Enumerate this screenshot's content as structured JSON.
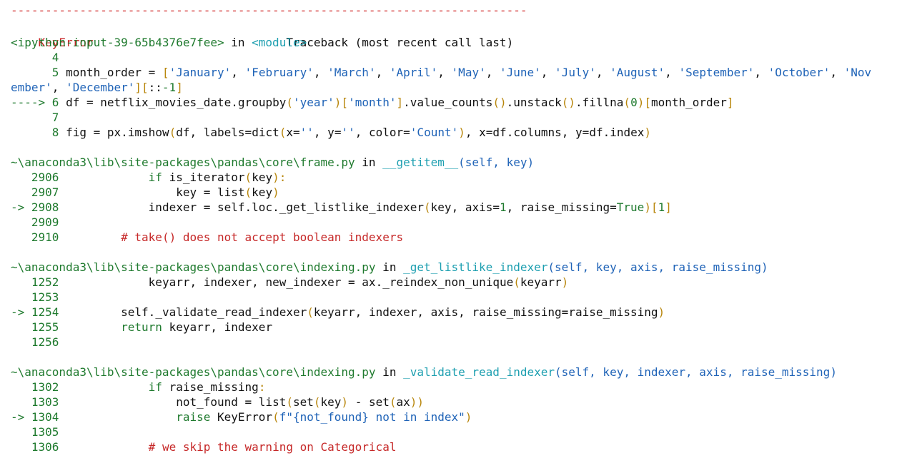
{
  "header": {
    "rule": "---------------------------------------------------------------------------",
    "error_name": "KeyError",
    "traceback_label": "Traceback (most recent call last)"
  },
  "frames": [
    {
      "location": "<ipython-input-39-65b4376e7fee>",
      "in_word": "in",
      "func": "<module>",
      "args": "",
      "lines": [
        {
          "no": "4",
          "arrow": "",
          "segments": []
        },
        {
          "no": "5",
          "arrow": "",
          "segments": [
            {
              "t": "month_order ",
              "c": "plain"
            },
            {
              "t": "= ",
              "c": "plain"
            },
            {
              "t": "[",
              "c": "punc"
            },
            {
              "t": "'January'",
              "c": "str"
            },
            {
              "t": ", ",
              "c": "plain"
            },
            {
              "t": "'February'",
              "c": "str"
            },
            {
              "t": ", ",
              "c": "plain"
            },
            {
              "t": "'March'",
              "c": "str"
            },
            {
              "t": ", ",
              "c": "plain"
            },
            {
              "t": "'April'",
              "c": "str"
            },
            {
              "t": ", ",
              "c": "plain"
            },
            {
              "t": "'May'",
              "c": "str"
            },
            {
              "t": ", ",
              "c": "plain"
            },
            {
              "t": "'June'",
              "c": "str"
            },
            {
              "t": ", ",
              "c": "plain"
            },
            {
              "t": "'July'",
              "c": "str"
            },
            {
              "t": ", ",
              "c": "plain"
            },
            {
              "t": "'August'",
              "c": "str"
            },
            {
              "t": ", ",
              "c": "plain"
            },
            {
              "t": "'September'",
              "c": "str"
            },
            {
              "t": ", ",
              "c": "plain"
            },
            {
              "t": "'October'",
              "c": "str"
            },
            {
              "t": ", ",
              "c": "plain"
            },
            {
              "t": "'Nov",
              "c": "str"
            }
          ]
        },
        {
          "no": "",
          "arrow": "",
          "continuation": true,
          "segments": [
            {
              "t": "ember'",
              "c": "str"
            },
            {
              "t": ", ",
              "c": "plain"
            },
            {
              "t": "'December'",
              "c": "str"
            },
            {
              "t": "][",
              "c": "punc"
            },
            {
              "t": "::",
              "c": "plain"
            },
            {
              "t": "-1",
              "c": "num"
            },
            {
              "t": "]",
              "c": "punc"
            }
          ]
        },
        {
          "no": "6",
          "arrow": "---->",
          "segments": [
            {
              "t": "df ",
              "c": "plain"
            },
            {
              "t": "= ",
              "c": "plain"
            },
            {
              "t": "netflix_movies_date",
              "c": "plain"
            },
            {
              "t": ".",
              "c": "plain"
            },
            {
              "t": "groupby",
              "c": "plain"
            },
            {
              "t": "(",
              "c": "punc"
            },
            {
              "t": "'year'",
              "c": "str"
            },
            {
              "t": ")[",
              "c": "punc"
            },
            {
              "t": "'month'",
              "c": "str"
            },
            {
              "t": "]",
              "c": "punc"
            },
            {
              "t": ".",
              "c": "plain"
            },
            {
              "t": "value_counts",
              "c": "plain"
            },
            {
              "t": "()",
              "c": "punc"
            },
            {
              "t": ".",
              "c": "plain"
            },
            {
              "t": "unstack",
              "c": "plain"
            },
            {
              "t": "()",
              "c": "punc"
            },
            {
              "t": ".",
              "c": "plain"
            },
            {
              "t": "fillna",
              "c": "plain"
            },
            {
              "t": "(",
              "c": "punc"
            },
            {
              "t": "0",
              "c": "num"
            },
            {
              "t": ")[",
              "c": "punc"
            },
            {
              "t": "month_order",
              "c": "plain"
            },
            {
              "t": "]",
              "c": "punc"
            }
          ]
        },
        {
          "no": "7",
          "arrow": "",
          "segments": []
        },
        {
          "no": "8",
          "arrow": "",
          "segments": [
            {
              "t": "fig ",
              "c": "plain"
            },
            {
              "t": "= ",
              "c": "plain"
            },
            {
              "t": "px",
              "c": "plain"
            },
            {
              "t": ".",
              "c": "plain"
            },
            {
              "t": "imshow",
              "c": "plain"
            },
            {
              "t": "(",
              "c": "punc"
            },
            {
              "t": "df",
              "c": "plain"
            },
            {
              "t": ", ",
              "c": "plain"
            },
            {
              "t": "labels",
              "c": "plain"
            },
            {
              "t": "=",
              "c": "plain"
            },
            {
              "t": "dict",
              "c": "plain"
            },
            {
              "t": "(",
              "c": "punc"
            },
            {
              "t": "x",
              "c": "plain"
            },
            {
              "t": "=",
              "c": "plain"
            },
            {
              "t": "''",
              "c": "str"
            },
            {
              "t": ", ",
              "c": "plain"
            },
            {
              "t": "y",
              "c": "plain"
            },
            {
              "t": "=",
              "c": "plain"
            },
            {
              "t": "''",
              "c": "str"
            },
            {
              "t": ", ",
              "c": "plain"
            },
            {
              "t": "color",
              "c": "plain"
            },
            {
              "t": "=",
              "c": "plain"
            },
            {
              "t": "'Count'",
              "c": "str"
            },
            {
              "t": ")",
              "c": "punc"
            },
            {
              "t": ", ",
              "c": "plain"
            },
            {
              "t": "x",
              "c": "plain"
            },
            {
              "t": "=",
              "c": "plain"
            },
            {
              "t": "df",
              "c": "plain"
            },
            {
              "t": ".",
              "c": "plain"
            },
            {
              "t": "columns",
              "c": "plain"
            },
            {
              "t": ", ",
              "c": "plain"
            },
            {
              "t": "y",
              "c": "plain"
            },
            {
              "t": "=",
              "c": "plain"
            },
            {
              "t": "df",
              "c": "plain"
            },
            {
              "t": ".",
              "c": "plain"
            },
            {
              "t": "index",
              "c": "plain"
            },
            {
              "t": ")",
              "c": "punc"
            }
          ]
        }
      ]
    },
    {
      "location": "~\\anaconda3\\lib\\site-packages\\pandas\\core\\frame.py",
      "in_word": "in",
      "func": "__getitem__",
      "args": "(self, key)",
      "lines": [
        {
          "no": "2906",
          "arrow": "",
          "segments": [
            {
              "t": "            ",
              "c": "plain"
            },
            {
              "t": "if ",
              "c": "kw"
            },
            {
              "t": "is_iterator",
              "c": "plain"
            },
            {
              "t": "(",
              "c": "punc"
            },
            {
              "t": "key",
              "c": "plain"
            },
            {
              "t": "):",
              "c": "punc"
            }
          ]
        },
        {
          "no": "2907",
          "arrow": "",
          "segments": [
            {
              "t": "                ",
              "c": "plain"
            },
            {
              "t": "key ",
              "c": "plain"
            },
            {
              "t": "= ",
              "c": "plain"
            },
            {
              "t": "list",
              "c": "plain"
            },
            {
              "t": "(",
              "c": "punc"
            },
            {
              "t": "key",
              "c": "plain"
            },
            {
              "t": ")",
              "c": "punc"
            }
          ]
        },
        {
          "no": "2908",
          "arrow": "->",
          "segments": [
            {
              "t": "            ",
              "c": "plain"
            },
            {
              "t": "indexer ",
              "c": "plain"
            },
            {
              "t": "= ",
              "c": "plain"
            },
            {
              "t": "self",
              "c": "plain"
            },
            {
              "t": ".",
              "c": "plain"
            },
            {
              "t": "loc",
              "c": "plain"
            },
            {
              "t": ".",
              "c": "plain"
            },
            {
              "t": "_get_listlike_indexer",
              "c": "plain"
            },
            {
              "t": "(",
              "c": "punc"
            },
            {
              "t": "key",
              "c": "plain"
            },
            {
              "t": ", ",
              "c": "plain"
            },
            {
              "t": "axis",
              "c": "plain"
            },
            {
              "t": "=",
              "c": "plain"
            },
            {
              "t": "1",
              "c": "num"
            },
            {
              "t": ", ",
              "c": "plain"
            },
            {
              "t": "raise_missing",
              "c": "plain"
            },
            {
              "t": "=",
              "c": "plain"
            },
            {
              "t": "True",
              "c": "kw"
            },
            {
              "t": ")[",
              "c": "punc"
            },
            {
              "t": "1",
              "c": "num"
            },
            {
              "t": "]",
              "c": "punc"
            }
          ]
        },
        {
          "no": "2909",
          "arrow": "",
          "segments": []
        },
        {
          "no": "2910",
          "arrow": "",
          "segments": [
            {
              "t": "        ",
              "c": "plain"
            },
            {
              "t": "# take() does not accept boolean indexers",
              "c": "comment"
            }
          ]
        }
      ]
    },
    {
      "location": "~\\anaconda3\\lib\\site-packages\\pandas\\core\\indexing.py",
      "in_word": "in",
      "func": "_get_listlike_indexer",
      "args": "(self, key, axis, raise_missing)",
      "lines": [
        {
          "no": "1252",
          "arrow": "",
          "segments": [
            {
              "t": "            ",
              "c": "plain"
            },
            {
              "t": "keyarr",
              "c": "plain"
            },
            {
              "t": ", ",
              "c": "plain"
            },
            {
              "t": "indexer",
              "c": "plain"
            },
            {
              "t": ", ",
              "c": "plain"
            },
            {
              "t": "new_indexer ",
              "c": "plain"
            },
            {
              "t": "= ",
              "c": "plain"
            },
            {
              "t": "ax",
              "c": "plain"
            },
            {
              "t": ".",
              "c": "plain"
            },
            {
              "t": "_reindex_non_unique",
              "c": "plain"
            },
            {
              "t": "(",
              "c": "punc"
            },
            {
              "t": "keyarr",
              "c": "plain"
            },
            {
              "t": ")",
              "c": "punc"
            }
          ]
        },
        {
          "no": "1253",
          "arrow": "",
          "segments": []
        },
        {
          "no": "1254",
          "arrow": "->",
          "segments": [
            {
              "t": "        ",
              "c": "plain"
            },
            {
              "t": "self",
              "c": "plain"
            },
            {
              "t": ".",
              "c": "plain"
            },
            {
              "t": "_validate_read_indexer",
              "c": "plain"
            },
            {
              "t": "(",
              "c": "punc"
            },
            {
              "t": "keyarr",
              "c": "plain"
            },
            {
              "t": ", ",
              "c": "plain"
            },
            {
              "t": "indexer",
              "c": "plain"
            },
            {
              "t": ", ",
              "c": "plain"
            },
            {
              "t": "axis",
              "c": "plain"
            },
            {
              "t": ", ",
              "c": "plain"
            },
            {
              "t": "raise_missing",
              "c": "plain"
            },
            {
              "t": "=",
              "c": "plain"
            },
            {
              "t": "raise_missing",
              "c": "plain"
            },
            {
              "t": ")",
              "c": "punc"
            }
          ]
        },
        {
          "no": "1255",
          "arrow": "",
          "segments": [
            {
              "t": "        ",
              "c": "plain"
            },
            {
              "t": "return ",
              "c": "kw"
            },
            {
              "t": "keyarr",
              "c": "plain"
            },
            {
              "t": ", ",
              "c": "plain"
            },
            {
              "t": "indexer",
              "c": "plain"
            }
          ]
        },
        {
          "no": "1256",
          "arrow": "",
          "segments": []
        }
      ]
    },
    {
      "location": "~\\anaconda3\\lib\\site-packages\\pandas\\core\\indexing.py",
      "in_word": "in",
      "func": "_validate_read_indexer",
      "args": "(self, key, indexer, axis, raise_missing)",
      "lines": [
        {
          "no": "1302",
          "arrow": "",
          "segments": [
            {
              "t": "            ",
              "c": "plain"
            },
            {
              "t": "if ",
              "c": "kw"
            },
            {
              "t": "raise_missing",
              "c": "plain"
            },
            {
              "t": ":",
              "c": "punc"
            }
          ]
        },
        {
          "no": "1303",
          "arrow": "",
          "segments": [
            {
              "t": "                ",
              "c": "plain"
            },
            {
              "t": "not_found ",
              "c": "plain"
            },
            {
              "t": "= ",
              "c": "plain"
            },
            {
              "t": "list",
              "c": "plain"
            },
            {
              "t": "(",
              "c": "punc"
            },
            {
              "t": "set",
              "c": "plain"
            },
            {
              "t": "(",
              "c": "punc"
            },
            {
              "t": "key",
              "c": "plain"
            },
            {
              "t": ") ",
              "c": "punc"
            },
            {
              "t": "- ",
              "c": "plain"
            },
            {
              "t": "set",
              "c": "plain"
            },
            {
              "t": "(",
              "c": "punc"
            },
            {
              "t": "ax",
              "c": "plain"
            },
            {
              "t": "))",
              "c": "punc"
            }
          ]
        },
        {
          "no": "1304",
          "arrow": "->",
          "segments": [
            {
              "t": "                ",
              "c": "plain"
            },
            {
              "t": "raise ",
              "c": "kw"
            },
            {
              "t": "KeyError",
              "c": "plain"
            },
            {
              "t": "(",
              "c": "punc"
            },
            {
              "t": "f\"{not_found} not in index\"",
              "c": "str"
            },
            {
              "t": ")",
              "c": "punc"
            }
          ]
        },
        {
          "no": "1305",
          "arrow": "",
          "segments": []
        },
        {
          "no": "1306",
          "arrow": "",
          "segments": [
            {
              "t": "            ",
              "c": "plain"
            },
            {
              "t": "# we skip the warning on Categorical",
              "c": "comment"
            }
          ]
        }
      ]
    }
  ]
}
